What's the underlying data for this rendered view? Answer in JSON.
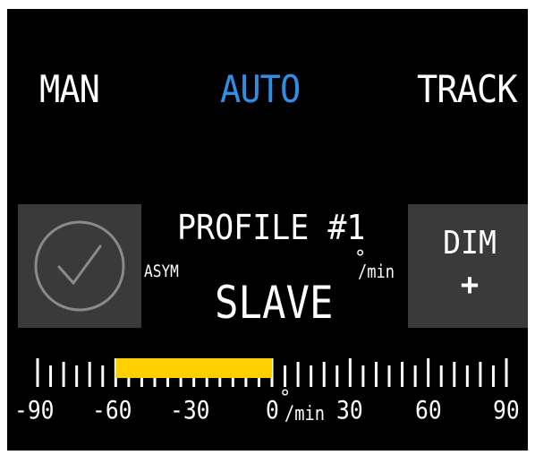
{
  "modes": {
    "man": "MAN",
    "auto": "AUTO",
    "track": "TRACK",
    "selected": "AUTO"
  },
  "profile": {
    "title": "PROFILE #1",
    "left_label": "ASYM",
    "main_label": "SLAVE",
    "rate_unit_symbol": "°",
    "rate_unit_suffix": "/min"
  },
  "dim_button": {
    "label": "DIM",
    "sub": "+"
  },
  "confirm_button": {
    "icon": "checkmark-circle-icon"
  },
  "scale": {
    "min": -90,
    "max": 90,
    "major_step": 30,
    "tick_labels": [
      "-90",
      "-60",
      "-30",
      "0",
      "30",
      "60",
      "90"
    ],
    "unit_symbol": "°",
    "unit_suffix": "/min",
    "range_start": -60,
    "range_end": 0
  },
  "colors": {
    "background": "#000000",
    "text": "#ffffff",
    "selected": "#2e8fe6",
    "button_bg": "#3a3a3a",
    "range_fill": "#ffd000",
    "icon_stroke": "#8a8a8a"
  }
}
